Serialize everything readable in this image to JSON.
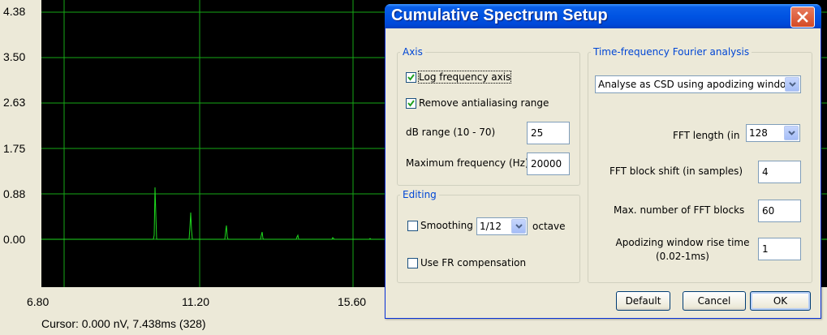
{
  "plot": {
    "y_ticks": [
      "4.38",
      "3.50",
      "2.63",
      "1.75",
      "0.88",
      "0.00"
    ],
    "x_ticks": [
      "6.80",
      "11.20",
      "15.60"
    ],
    "cursor_readout": "Cursor: 0.000 nV, 7.438ms (328)",
    "colors": {
      "background": "#000000",
      "grid": "#16a816",
      "trace": "#1ed81e"
    }
  },
  "dialog": {
    "title": "Cumulative Spectrum Setup",
    "close_icon": "close-icon",
    "axis_group": {
      "label": "Axis",
      "log_frequency_axis": {
        "label": "Log frequency axis",
        "checked": true
      },
      "remove_antialiasing": {
        "label": "Remove antialiasing range",
        "checked": true
      },
      "db_range": {
        "label": "dB range (10 - 70)",
        "value": "25"
      },
      "max_frequency": {
        "label": "Maximum frequency (Hz)",
        "value": "20000"
      }
    },
    "editing_group": {
      "label": "Editing",
      "smoothing": {
        "label": "Smoothing",
        "checked": false,
        "select_value": "1/12",
        "suffix": "octave"
      },
      "fr_compensation": {
        "label": "Use FR compensation",
        "checked": false
      }
    },
    "tf_group": {
      "label": "Time-frequency Fourier analysis",
      "analysis_mode": "Analyse as CSD using apodizing window",
      "fft_length": {
        "label": "FFT length (in",
        "value": "128"
      },
      "fft_block_shift": {
        "label": "FFT block shift (in samples)",
        "value": "4"
      },
      "max_fft_blocks": {
        "label": "Max. number of FFT blocks",
        "value": "60"
      },
      "apodizing_rise": {
        "label_line1": "Apodizing window rise time",
        "label_line2": "(0.02-1ms)",
        "value": "1"
      }
    },
    "buttons": {
      "default": "Default",
      "cancel": "Cancel",
      "ok": "OK"
    }
  }
}
